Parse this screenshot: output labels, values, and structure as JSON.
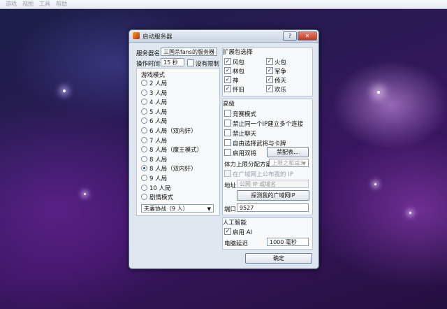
{
  "menu": [
    "游戏",
    "视图",
    "工具",
    "帮助"
  ],
  "window": {
    "title": "启动服务器",
    "help_label": "?",
    "close_label": "✕"
  },
  "left": {
    "server_name_label": "服务器名",
    "server_name_value": "三国杀fans的服务器",
    "op_time_label": "操作时间",
    "op_time_value": "15 秒",
    "no_limit_label": "没有限制",
    "mode_label": "游戏模式",
    "modes": [
      {
        "label": "2 人局",
        "selected": false
      },
      {
        "label": "3 人局",
        "selected": false
      },
      {
        "label": "4 人局",
        "selected": false
      },
      {
        "label": "5 人局",
        "selected": false
      },
      {
        "label": "6 人局",
        "selected": false
      },
      {
        "label": "6 人局（双内奸）",
        "selected": false
      },
      {
        "label": "7 人局",
        "selected": false
      },
      {
        "label": "8 人局（魔王模式）",
        "selected": false
      },
      {
        "label": "8 人局",
        "selected": false
      },
      {
        "label": "8 人局（双内奸）",
        "selected": true
      },
      {
        "label": "9 人局",
        "selected": false
      },
      {
        "label": "10 人局",
        "selected": false
      },
      {
        "label": "剧情模式",
        "selected": false
      }
    ],
    "scenario_value": "夫妻协战（9 人）"
  },
  "right": {
    "packages_label": "扩展包选择",
    "packages": [
      {
        "label": "风包",
        "checked": true
      },
      {
        "label": "火包",
        "checked": true
      },
      {
        "label": "林包",
        "checked": true
      },
      {
        "label": "军争",
        "checked": true
      },
      {
        "label": "神",
        "checked": true
      },
      {
        "label": "倚天",
        "checked": true
      },
      {
        "label": "怀旧",
        "checked": true
      },
      {
        "label": "欢乐",
        "checked": true
      }
    ],
    "advanced_label": "高级",
    "contest_mode_label": "竞赛模式",
    "no_multi_conn_label": "禁止同一个IP建立多个连接",
    "no_chat_label": "禁止聊天",
    "free_choose_label": "自由选择武将与卡牌",
    "dual_general_label": "启用双将",
    "ban_table_label": "禁配表...",
    "hp_scheme_label": "体力上限分配方案",
    "hp_scheme_value": "上限之和减3",
    "lan_publish_label": "在广域网上公布我的 IP",
    "address_label": "地址",
    "address_placeholder": "公网 IP 或域名",
    "detect_wan_label": "探测我的广域网IP",
    "port_label": "端口",
    "port_value": "9527",
    "ai_label": "人工智能",
    "enable_ai_label": "启用 AI",
    "ai_delay_label": "电脑延迟",
    "ai_delay_value": "1000 毫秒",
    "start_label": "确定"
  }
}
